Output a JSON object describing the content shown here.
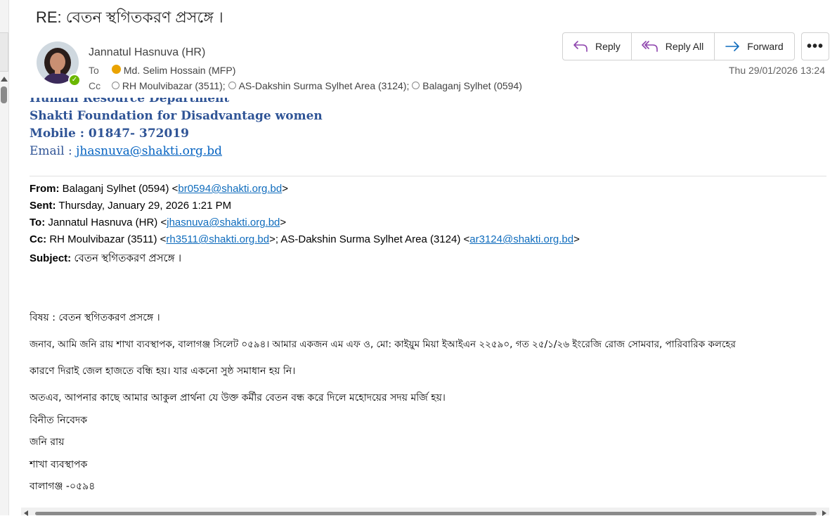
{
  "subject": "RE: বেতন স্থগিতকরণ প্রসঙ্গে ।",
  "sender": {
    "name": "Jannatul Hasnuva (HR)"
  },
  "to": {
    "label": "To",
    "recipient": "Md. Selim Hossain (MFP)"
  },
  "cc": {
    "label": "Cc",
    "recipients": [
      "RH Moulvibazar (3511);",
      "AS-Dakshin Surma Sylhet Area (3124);",
      "Balaganj Sylhet (0594)"
    ]
  },
  "actions": {
    "reply": "Reply",
    "reply_all": "Reply All",
    "forward": "Forward",
    "more": "•••"
  },
  "date": "Thu 29/01/2026 13:24",
  "signature": {
    "department": "Human Resource Department",
    "org": "Shakti Foundation for Disadvantage women",
    "mobile_label": "Mobile",
    "mobile": "01847- 372019",
    "email_label": "Email",
    "email": "jhasnuva@shakti.org.bd"
  },
  "quoted": {
    "from_label": "From:",
    "from_name": "Balaganj Sylhet (0594) <",
    "from_email": "br0594@shakti.org.bd",
    "sent_label": "Sent:",
    "sent": "Thursday, January 29, 2026 1:21 PM",
    "to_label": "To:",
    "to_name": "Jannatul Hasnuva (HR) <",
    "to_email": "jhasnuva@shakti.org.bd",
    "cc_label": "Cc:",
    "cc1_name": "RH Moulvibazar (3511) <",
    "cc1_email": "rh3511@shakti.org.bd",
    "cc_sep": ">; AS-Dakshin Surma Sylhet Area (3124) <",
    "cc2_email": "ar3124@shakti.org.bd",
    "subject_label": "Subject:",
    "subject": "বেতন স্থগিতকরণ প্রসঙ্গে ।"
  },
  "body": {
    "line1": "বিষয় : বেতন স্থগিতকরণ প্রসঙ্গে ।",
    "line2": "জনাব, আমি জনি রায় শাখা ব্যবস্থাপক, বালাগঞ্জ সিলেট ০৫৯৪।  আমার একজন এম এফ ও, মো: কাইয়ুম মিয়া ইআইএন ২২৫৯০, গত ২৫/১/২৬ ইংরেজি রোজ সোমবার, পারিবারিক কলহের",
    "line3": "কারণে দিরাই জেল হাজতে বন্ধি হয়।  যার একনো সুষ্ঠ সমাধান হয় নি।",
    "line4": "অতএব, আপনার কাছে আমার আকুল প্রার্থনা যে উক্ত কর্মীর বেতন বন্ধ করে দিলে মহোদয়ের সদয় মর্জি হয়।",
    "line5": "বিনীত নিবেদক",
    "line6": "জনি রায়",
    "line7": "শাখা ব্যবস্থাপক",
    "line8": "বালাগঞ্জ -০৫৯৪"
  }
}
